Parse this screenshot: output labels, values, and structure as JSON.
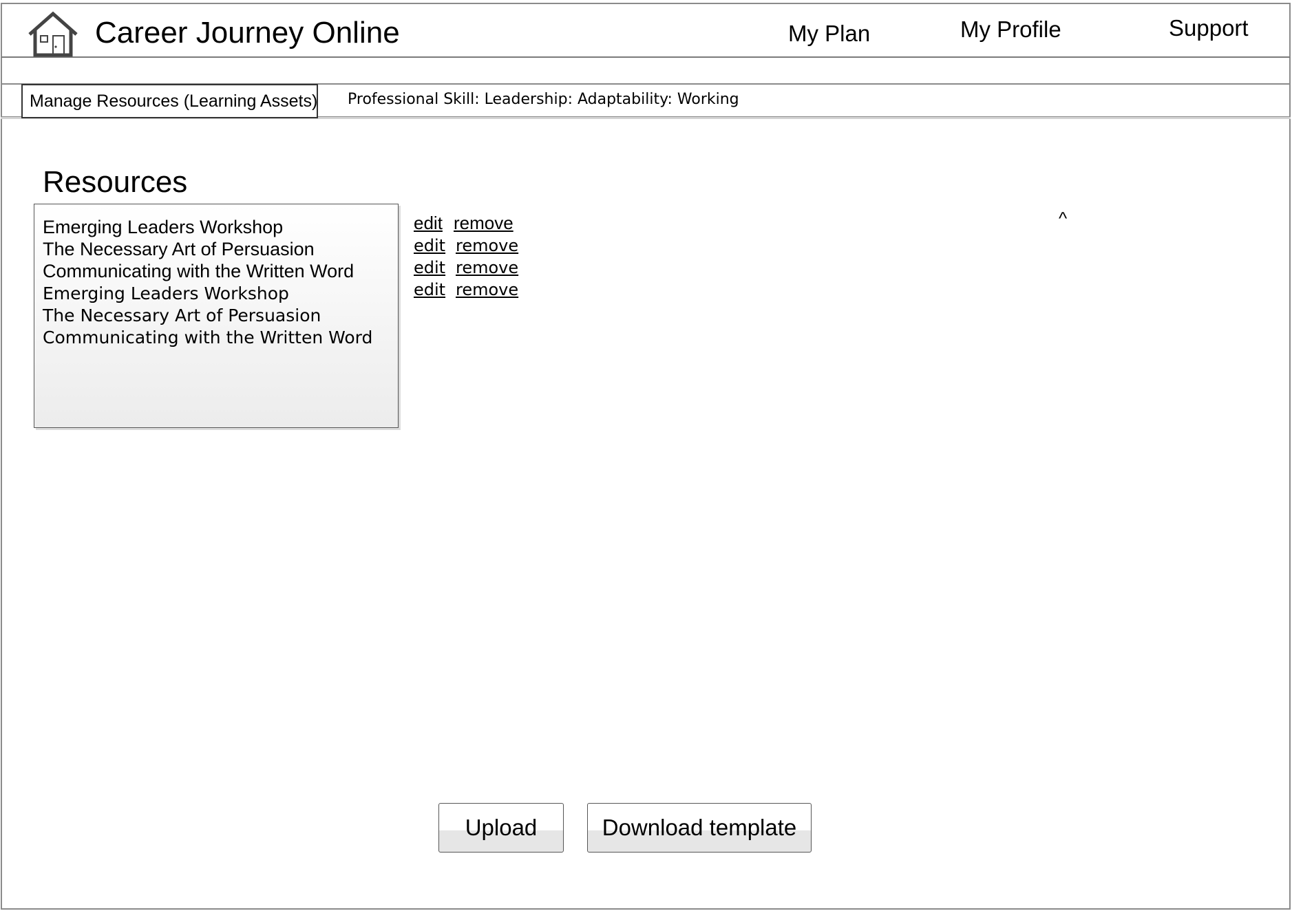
{
  "header": {
    "app_title": "Career Journey Online",
    "logo_icon": "home-icon",
    "nav": [
      "My Plan",
      "My Profile",
      "Support"
    ]
  },
  "toolbar": {
    "active_tab": "Manage Resources (Learning Assets)",
    "breadcrumb": "Professional Skill: Leadership: Adaptability: Working"
  },
  "main": {
    "section_title": "Resources",
    "resources": [
      "Emerging Leaders Workshop",
      "The Necessary Art of Persuasion",
      "Communicating with the Written Word",
      "Emerging Leaders Workshop",
      "The Necessary Art of Persuasion",
      "Communicating with the Written Word"
    ],
    "actions": [
      {
        "edit": "edit",
        "remove": "remove"
      },
      {
        "edit": "edit",
        "remove": "remove"
      },
      {
        "edit": "edit",
        "remove": "remove"
      },
      {
        "edit": "edit",
        "remove": "remove"
      }
    ],
    "caret": "^"
  },
  "buttons": {
    "upload": "Upload",
    "download_template": "Download template"
  }
}
